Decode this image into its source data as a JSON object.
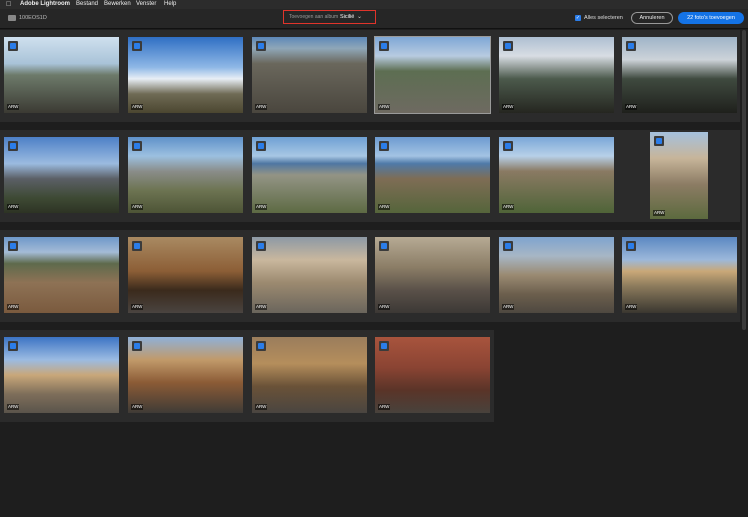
{
  "menubar": {
    "apple_icon": "apple-icon",
    "items": [
      "Adobe Lightroom",
      "Bestand",
      "Bewerken",
      "Venster",
      "Help"
    ]
  },
  "toolbar": {
    "folder_icon": "folder-icon",
    "folder_name": "100EOS1D",
    "album_label": "Toevoegen aan album",
    "album_value": "Sicilië",
    "chevron_icon": "chevron-down-icon",
    "select_all_label": "Alles selecteren",
    "select_all_checked": true,
    "cancel_label": "Annuleren",
    "add_label": "22 foto's toevoegen",
    "accent_color": "#1473e6",
    "highlight_color": "#e0342b"
  },
  "photos": [
    {
      "badge": "ARW",
      "checked": true,
      "type": "landscape"
    },
    {
      "badge": "ARW",
      "checked": true,
      "type": "landscape"
    },
    {
      "badge": "ARW",
      "checked": true,
      "type": "landscape"
    },
    {
      "badge": "ARW",
      "checked": true,
      "type": "landscape"
    },
    {
      "badge": "ARW",
      "checked": true,
      "type": "landscape"
    },
    {
      "badge": "ARW",
      "checked": true,
      "type": "landscape"
    },
    {
      "badge": "ARW",
      "checked": true,
      "type": "landscape"
    },
    {
      "badge": "ARW",
      "checked": true,
      "type": "landscape"
    },
    {
      "badge": "ARW",
      "checked": true,
      "type": "landscape"
    },
    {
      "badge": "ARW",
      "checked": true,
      "type": "landscape"
    },
    {
      "badge": "ARW",
      "checked": true,
      "type": "landscape"
    },
    {
      "badge": "ARW",
      "checked": true,
      "type": "portrait"
    },
    {
      "badge": "ARW",
      "checked": true,
      "type": "landscape"
    },
    {
      "badge": "ARW",
      "checked": true,
      "type": "landscape"
    },
    {
      "badge": "ARW",
      "checked": true,
      "type": "landscape"
    },
    {
      "badge": "ARW",
      "checked": true,
      "type": "landscape"
    },
    {
      "badge": "ARW",
      "checked": true,
      "type": "landscape"
    },
    {
      "badge": "ARW",
      "checked": true,
      "type": "landscape"
    },
    {
      "badge": "ARW",
      "checked": true,
      "type": "landscape"
    },
    {
      "badge": "ARW",
      "checked": true,
      "type": "landscape"
    },
    {
      "badge": "ARW",
      "checked": true,
      "type": "landscape"
    },
    {
      "badge": "ARW",
      "checked": true,
      "type": "landscape"
    }
  ]
}
